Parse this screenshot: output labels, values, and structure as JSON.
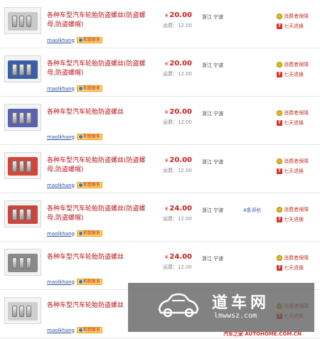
{
  "listings": [
    {
      "title": "各种车型汽车轮胎防盗螺丝(防盗螺母,防盗螺帽)",
      "price": "20.00",
      "shipping": "运费：12.00",
      "location": "浙江 宁波",
      "reviews": "",
      "seller": "maolkhang",
      "plate_color": "#c9c9c9"
    },
    {
      "title": "各种车型汽车轮胎防盗螺丝(防盗螺母,防盗螺帽)",
      "price": "20.00",
      "shipping": "运费：12.00",
      "location": "浙江 宁波",
      "reviews": "",
      "seller": "maolkhang",
      "plate_color": "#3a5fa8"
    },
    {
      "title": "各种车型汽车轮胎防盗螺丝",
      "price": "20.00",
      "shipping": "运费：12.00",
      "location": "浙江 宁波",
      "reviews": "",
      "seller": "maolkhang",
      "plate_color": "#5a62b0"
    },
    {
      "title": "各种车型汽车轮胎防盗螺丝(防盗螺母,防盗螺帽)",
      "price": "20.00",
      "shipping": "运费：12.00",
      "location": "浙江 宁波",
      "reviews": "",
      "seller": "maolkhang",
      "plate_color": "#d0473a"
    },
    {
      "title": "各种车型汽车轮胎防盗螺丝(防盗螺母,防盗螺帽)",
      "price": "24.00",
      "shipping": "运费：12.00",
      "location": "浙江 宁波",
      "reviews": "4条评价",
      "seller": "maolkhang",
      "plate_color": "#c8463c"
    },
    {
      "title": "各种车型汽车轮胎防盗螺丝",
      "price": "24.00",
      "shipping": "运费：12.00",
      "location": "浙江 宁波",
      "reviews": "",
      "seller": "maolkhang",
      "plate_color": "#8a8a8a"
    },
    {
      "title": "各种车型汽车轮胎防盗螺丝",
      "price": "",
      "shipping": "",
      "location": "",
      "reviews": "",
      "seller": "maolkhang",
      "plate_color": "#cfcfcf"
    }
  ],
  "labels": {
    "currency": "¥",
    "contact": "和我联系",
    "guarantee": "消费者保障",
    "return": "七天退换",
    "seven_glyph": "7"
  },
  "watermark": {
    "title": "道车网",
    "url": "lmwwsz.com",
    "credit": "汽车之家 AUTOHOME.COM.CN"
  }
}
